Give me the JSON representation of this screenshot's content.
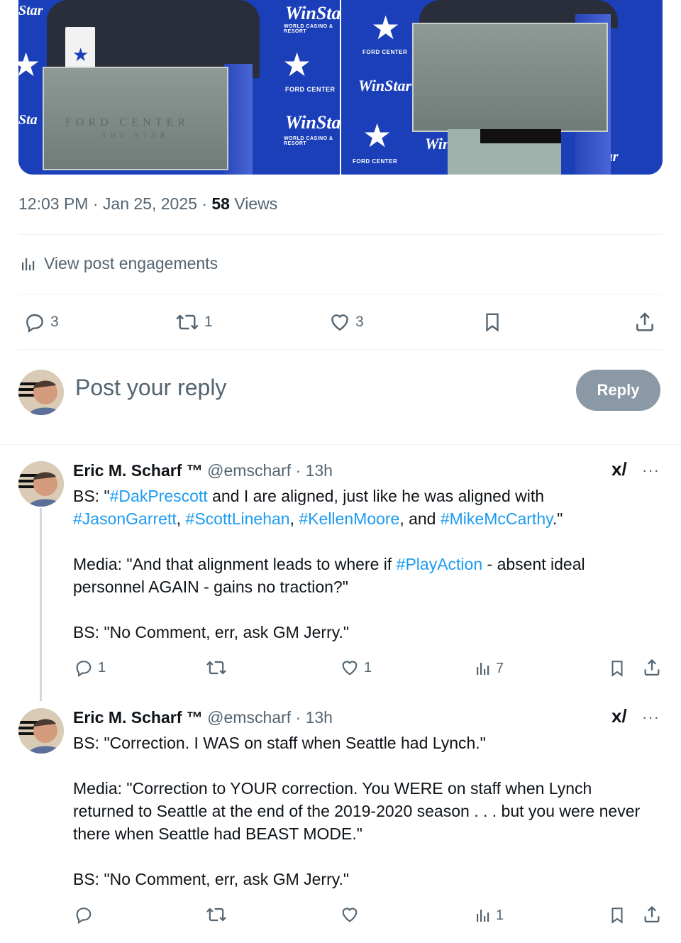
{
  "photos": {
    "left": {
      "brand": "WinStar",
      "brand_sub": "WORLD CASINO & RESORT",
      "ford": "FORD CENTER",
      "podium_text": "FORD CENTER",
      "podium_sub": "THE STAR"
    },
    "right": {
      "brand": "WinStar",
      "brand_sub": "WORLD CASINO & RESORT",
      "ford": "FORD CENTER"
    }
  },
  "post_meta": {
    "time": "12:03 PM",
    "date": "Jan 25, 2025",
    "views_count": "58",
    "views_label": "Views",
    "separator": "·"
  },
  "engagements_label": "View post engagements",
  "actions": {
    "replies": "3",
    "reposts": "1",
    "likes": "3"
  },
  "compose": {
    "placeholder": "Post your reply",
    "button": "Reply"
  },
  "replies": [
    {
      "name": "Eric M. Scharf ™",
      "handle": "@emscharf",
      "time": "13h",
      "line1_pre": "BS: \"",
      "line1_tag": "#DakPrescott",
      "line1_post": " and I are aligned, just like he was aligned with",
      "line2_tag1": "#JasonGarrett",
      "line2_sep1": ", ",
      "line2_tag2": "#ScottLinehan",
      "line2_sep2": ", ",
      "line2_tag3": "#KellenMoore",
      "line2_sep3": ", and ",
      "line2_tag4": "#MikeMcCarthy",
      "line2_end": ".\"",
      "para2_pre": "Media: \"And that alignment leads to where if ",
      "para2_tag": "#PlayAction",
      "para2_post": " - absent ideal personnel AGAIN - gains no traction?\"",
      "para3": "BS: \"No Comment, err, ask GM Jerry.\"",
      "stats": {
        "replies": "1",
        "reposts": "",
        "likes": "1",
        "views": "7"
      }
    },
    {
      "name": "Eric M. Scharf ™",
      "handle": "@emscharf",
      "time": "13h",
      "para1": "BS: \"Correction. I WAS on staff when Seattle had Lynch.\"",
      "para2": "Media: \"Correction to YOUR correction. You WERE on staff when Lynch returned to Seattle at the end of the 2019-2020 season . . . but you were never there when Seattle had BEAST MODE.\"",
      "para3": "BS: \"No Comment, err, ask GM Jerry.\"",
      "stats": {
        "replies": "",
        "reposts": "",
        "likes": "",
        "views": "1"
      }
    }
  ],
  "grok_label": "x/",
  "more_label": "···",
  "colors": {
    "link": "#1d9bf0",
    "muted": "#536471",
    "backdrop": "#1b3fb8",
    "reply_button": "#8b98a5"
  }
}
